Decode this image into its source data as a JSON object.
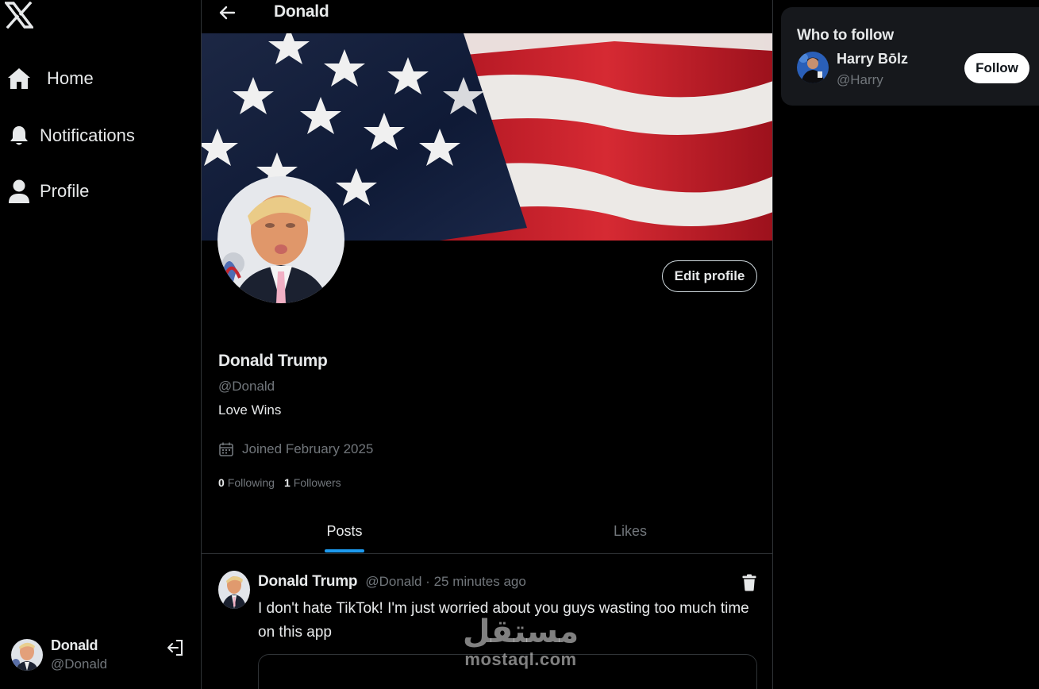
{
  "sidebar": {
    "logo_icon": "x-logo-icon",
    "items": [
      {
        "label": "Home",
        "icon": "home-icon"
      },
      {
        "label": "Notifications",
        "icon": "bell-icon"
      },
      {
        "label": "Profile",
        "icon": "user-icon"
      }
    ],
    "account": {
      "name": "Donald",
      "handle": "@Donald",
      "logout_icon": "logout-icon"
    }
  },
  "header": {
    "title": "Donald",
    "back_icon": "arrow-left-icon"
  },
  "profile": {
    "banner": "american-flag-image",
    "edit_label": "Edit profile",
    "display_name": "Donald Trump",
    "handle": "@Donald",
    "bio": "Love Wins",
    "joined": "Joined February 2025",
    "following_count": "0",
    "following_label": "Following",
    "followers_count": "1",
    "followers_label": "Followers"
  },
  "tabs": [
    {
      "label": "Posts",
      "active": true
    },
    {
      "label": "Likes",
      "active": false
    }
  ],
  "posts": [
    {
      "author": "Donald Trump",
      "meta": "@Donald · 25 minutes ago",
      "text": "I don't hate TikTok! I'm just worried about you guys wasting too much time on this app",
      "delete_icon": "trash-icon"
    }
  ],
  "who_to_follow": {
    "title": "Who to follow",
    "users": [
      {
        "name": "Harry Bōlz",
        "handle": "@Harry",
        "follow_label": "Follow"
      }
    ]
  },
  "watermark": {
    "arabic": "مستقل",
    "latin": "mostaql.com"
  },
  "colors": {
    "background": "#000000",
    "text": "#e7e9ea",
    "muted": "#71767b",
    "accent": "#1d9bf0",
    "border": "#2f3336",
    "panel": "#16181c"
  }
}
